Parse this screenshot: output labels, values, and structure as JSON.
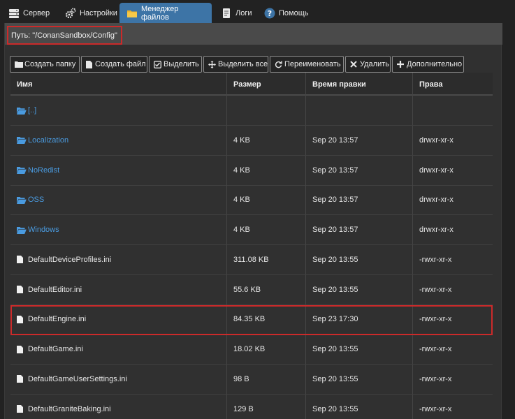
{
  "nav": {
    "tabs": [
      {
        "label": "Сервер",
        "icon": "server-icon"
      },
      {
        "label": "Настройки",
        "icon": "gears-icon"
      },
      {
        "label": "Менеджер файлов",
        "icon": "folder-icon"
      },
      {
        "label": "Логи",
        "icon": "document-icon"
      },
      {
        "label": "Помощь",
        "icon": "help-icon"
      }
    ],
    "active_tab": "Менеджер файлов"
  },
  "path": {
    "label": "Путь: \"/ConanSandbox/Config\""
  },
  "toolbar": {
    "create_folder": "Создать папку",
    "create_file": "Создать файл",
    "select": "Выделить",
    "select_all": "Выделить все",
    "rename": "Переименовать",
    "delete": "Удалить",
    "more": "Дополнительно"
  },
  "table": {
    "headers": {
      "name": "Имя",
      "size": "Размер",
      "modified": "Время правки",
      "perms": "Права"
    },
    "rows": [
      {
        "name": "[..]",
        "size": "",
        "modified": "",
        "perms": "",
        "type": "folder"
      },
      {
        "name": "Localization",
        "size": "4 KB",
        "modified": "Sep 20 13:57",
        "perms": "drwxr-xr-x",
        "type": "folder"
      },
      {
        "name": "NoRedist",
        "size": "4 KB",
        "modified": "Sep 20 13:57",
        "perms": "drwxr-xr-x",
        "type": "folder"
      },
      {
        "name": "OSS",
        "size": "4 KB",
        "modified": "Sep 20 13:57",
        "perms": "drwxr-xr-x",
        "type": "folder"
      },
      {
        "name": "Windows",
        "size": "4 KB",
        "modified": "Sep 20 13:57",
        "perms": "drwxr-xr-x",
        "type": "folder"
      },
      {
        "name": "DefaultDeviceProfiles.ini",
        "size": "311.08 KB",
        "modified": "Sep 20 13:55",
        "perms": "-rwxr-xr-x",
        "type": "file"
      },
      {
        "name": "DefaultEditor.ini",
        "size": "55.6 KB",
        "modified": "Sep 20 13:55",
        "perms": "-rwxr-xr-x",
        "type": "file"
      },
      {
        "name": "DefaultEngine.ini",
        "size": "84.35 KB",
        "modified": "Sep 23 17:30",
        "perms": "-rwxr-xr-x",
        "type": "file"
      },
      {
        "name": "DefaultGame.ini",
        "size": "18.02 KB",
        "modified": "Sep 20 13:55",
        "perms": "-rwxr-xr-x",
        "type": "file"
      },
      {
        "name": "DefaultGameUserSettings.ini",
        "size": "98 B",
        "modified": "Sep 20 13:55",
        "perms": "-rwxr-xr-x",
        "type": "file"
      },
      {
        "name": "DefaultGraniteBaking.ini",
        "size": "129 B",
        "modified": "Sep 20 13:55",
        "perms": "-rwxr-xr-x",
        "type": "file"
      }
    ]
  },
  "colors": {
    "accent": "#3d74a6",
    "folder": "#4a9be0",
    "highlight": "#cc2a2a"
  }
}
